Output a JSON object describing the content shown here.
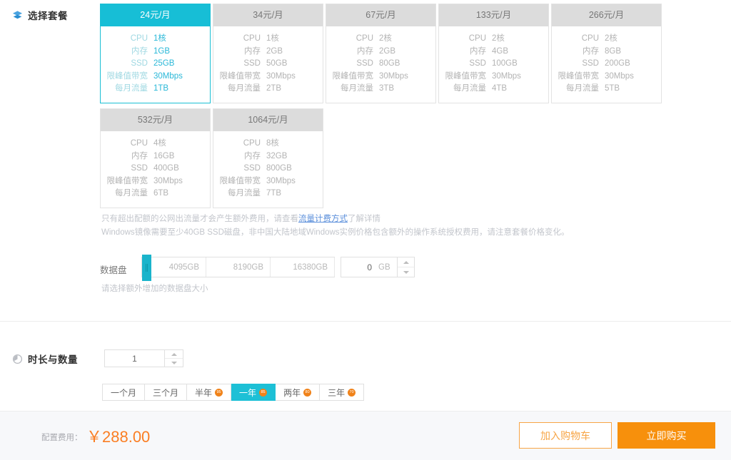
{
  "sections": {
    "package": {
      "title": "选择套餐",
      "icon": "layers-icon"
    },
    "duration": {
      "title": "时长与数量",
      "icon": "clock-icon"
    }
  },
  "spec_keys": {
    "cpu": "CPU",
    "mem": "内存",
    "ssd": "SSD",
    "bandwidth": "限峰值带宽",
    "traffic": "每月流量"
  },
  "packages": [
    {
      "price": "24元/月",
      "selected": true,
      "cpu": "1核",
      "mem": "1GB",
      "ssd": "25GB",
      "bandwidth": "30Mbps",
      "traffic": "1TB"
    },
    {
      "price": "34元/月",
      "selected": false,
      "cpu": "1核",
      "mem": "2GB",
      "ssd": "50GB",
      "bandwidth": "30Mbps",
      "traffic": "2TB"
    },
    {
      "price": "67元/月",
      "selected": false,
      "cpu": "2核",
      "mem": "2GB",
      "ssd": "80GB",
      "bandwidth": "30Mbps",
      "traffic": "3TB"
    },
    {
      "price": "133元/月",
      "selected": false,
      "cpu": "2核",
      "mem": "4GB",
      "ssd": "100GB",
      "bandwidth": "30Mbps",
      "traffic": "4TB"
    },
    {
      "price": "266元/月",
      "selected": false,
      "cpu": "2核",
      "mem": "8GB",
      "ssd": "200GB",
      "bandwidth": "30Mbps",
      "traffic": "5TB"
    },
    {
      "price": "532元/月",
      "selected": false,
      "cpu": "4核",
      "mem": "16GB",
      "ssd": "400GB",
      "bandwidth": "30Mbps",
      "traffic": "6TB"
    },
    {
      "price": "1064元/月",
      "selected": false,
      "cpu": "8核",
      "mem": "32GB",
      "ssd": "800GB",
      "bandwidth": "30Mbps",
      "traffic": "7TB"
    }
  ],
  "notes": {
    "line1_a": "只有超出配额的公网出流量才会产生额外费用，请查看",
    "line1_link": "流量计费方式",
    "line1_b": "了解详情",
    "line2": "Windows镜像需要至少40GB SSD磁盘，非中国大陆地域Windows实例价格包含额外的操作系统授权费用，请注意套餐价格变化。"
  },
  "data_disk": {
    "label": "数据盘",
    "ticks": [
      "4095GB",
      "8190GB",
      "16380GB"
    ],
    "value": "0",
    "unit": "GB",
    "hint": "请选择额外增加的数据盘大小"
  },
  "quantity": {
    "value": "1"
  },
  "durations": [
    {
      "label": "一个月",
      "badge": "",
      "active": false
    },
    {
      "label": "三个月",
      "badge": "",
      "active": false
    },
    {
      "label": "半年",
      "badge": "95",
      "active": false
    },
    {
      "label": "一年",
      "badge": "85",
      "active": true
    },
    {
      "label": "两年",
      "badge": "80",
      "active": false
    },
    {
      "label": "三年",
      "badge": "70",
      "active": false
    }
  ],
  "footer": {
    "fee_label": "配置费用：",
    "fee_value": "￥288.00",
    "add_cart_label": "加入购物车",
    "buy_now_label": "立即购买"
  },
  "colors": {
    "accent_cyan": "#1dc0d6",
    "accent_orange": "#f7900c",
    "price_orange": "#fa7e23",
    "badge_orange": "#f08219"
  }
}
